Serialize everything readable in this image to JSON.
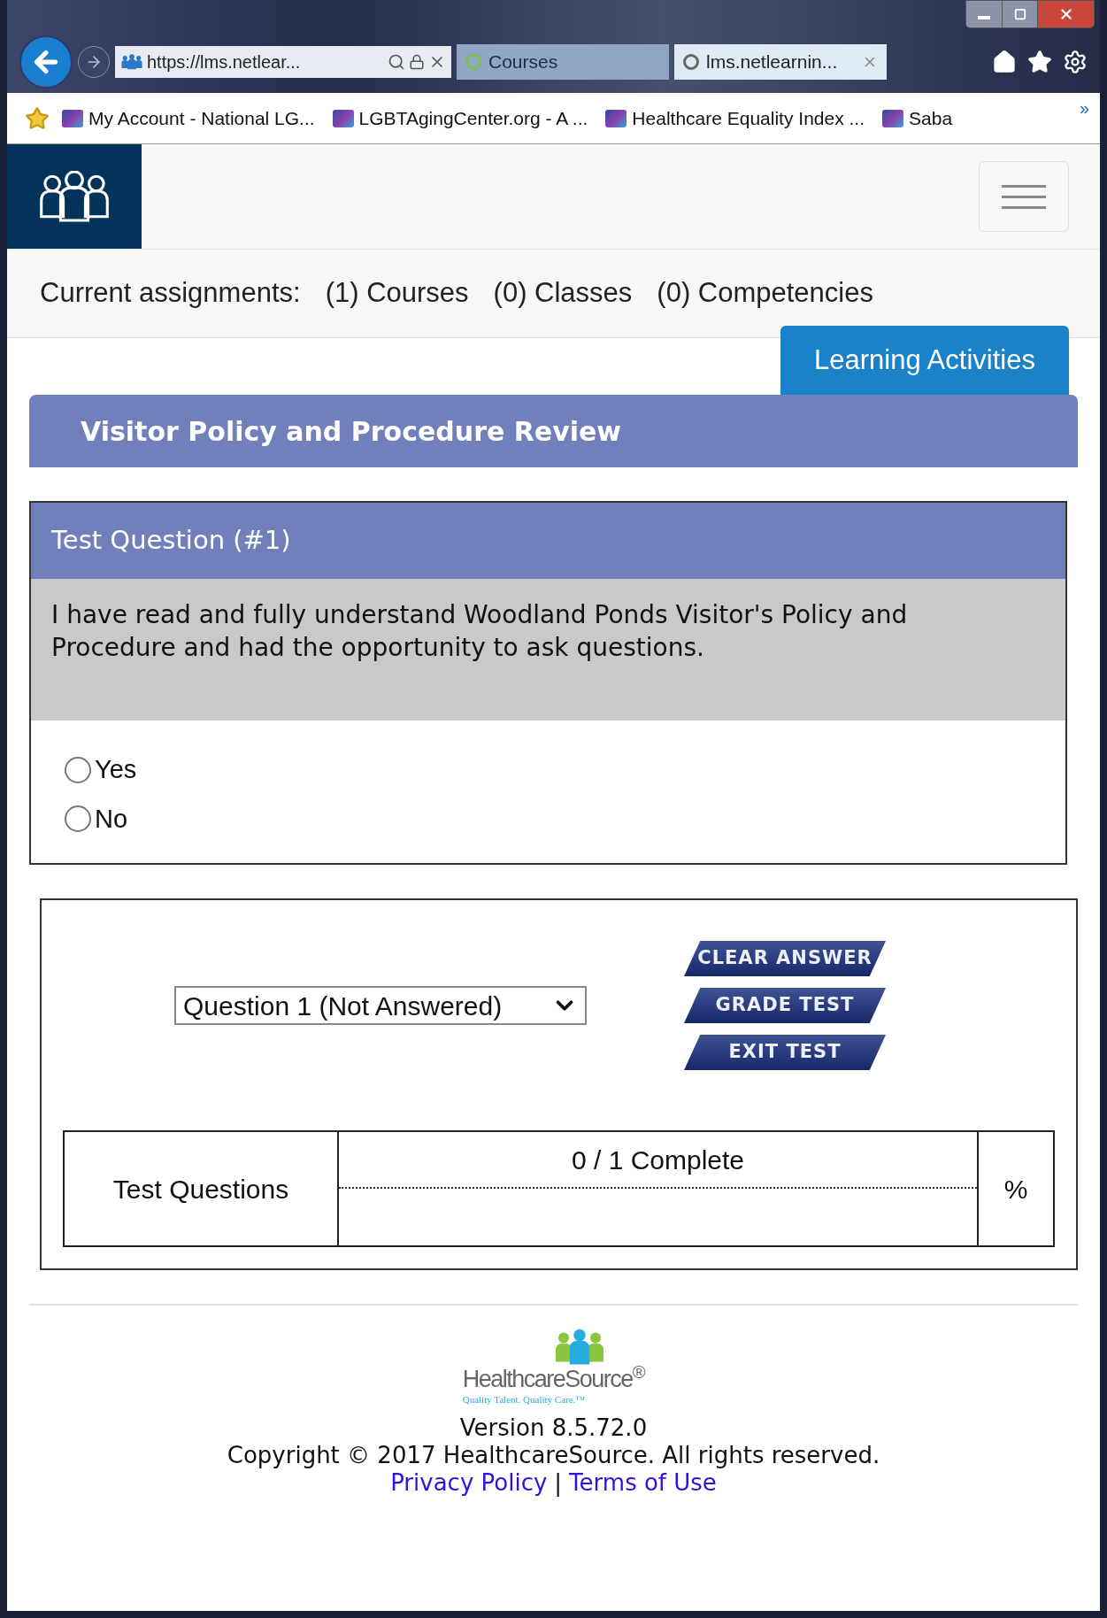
{
  "browser": {
    "address": "https://lms.netlear...",
    "tabs": [
      {
        "label": "Courses",
        "selected": false
      },
      {
        "label": "lms.netlearnin...",
        "selected": true
      }
    ],
    "favorites": [
      {
        "label": "My Account - National LG..."
      },
      {
        "label": "LGBTAgingCenter.org - A ..."
      },
      {
        "label": "Healthcare Equality Index ..."
      },
      {
        "label": "Saba"
      }
    ],
    "overflow": "»"
  },
  "assignments": {
    "label": "Current assignments:",
    "items": [
      "(1) Courses",
      "(0) Classes",
      "(0) Competencies"
    ]
  },
  "activities_button": "Learning Activities",
  "course_title": "Visitor Policy and Procedure Review",
  "question": {
    "header": "Test Question (#1)",
    "text": "I have read and fully understand Woodland Ponds Visitor's Policy and Procedure and had the opportunity to ask questions.",
    "options": [
      {
        "label": "Yes",
        "selected": false
      },
      {
        "label": "No",
        "selected": false
      }
    ]
  },
  "navigator": {
    "select_value": "Question 1 (Not Answered)",
    "buttons": [
      "CLEAR ANSWER",
      "GRADE TEST",
      "EXIT TEST"
    ]
  },
  "progress": {
    "label": "Test Questions",
    "reading": "0 / 1 Complete",
    "unit": "%"
  },
  "footer": {
    "logo_name": "HealthcareSource$^{®}$",
    "logo_tagline": "Quality Talent. Quality Care.™",
    "version": "Version 8.5.72.0",
    "copyright": "Copyright © 2017 HealthcareSource. All rights reserved.",
    "links": [
      "Privacy Policy",
      "Terms of Use"
    ],
    "separator": "|"
  }
}
